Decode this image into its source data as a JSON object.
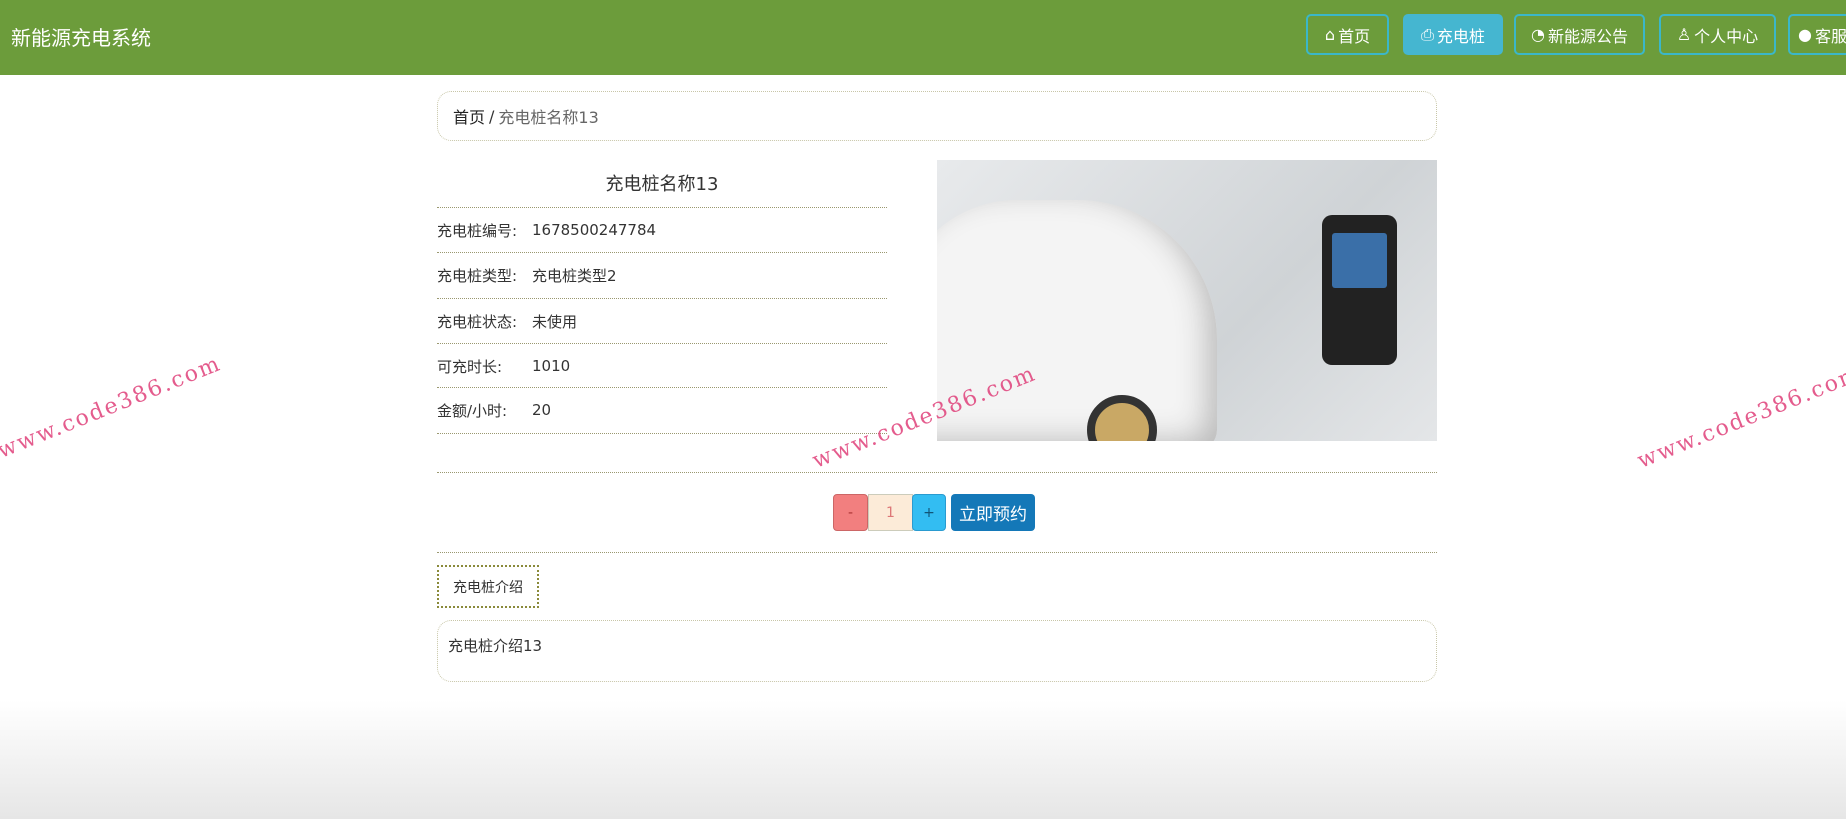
{
  "header": {
    "brand": "新能源充电系统",
    "nav": [
      {
        "label": "首页",
        "icon": "home-icon"
      },
      {
        "label": "充电桩",
        "icon": "charger-icon"
      },
      {
        "label": "新能源公告",
        "icon": "palette-icon"
      },
      {
        "label": "个人中心",
        "icon": "user-icon"
      },
      {
        "label": "客服",
        "icon": "chat-icon"
      }
    ]
  },
  "breadcrumb": {
    "home": "首页",
    "sep": "/",
    "current": "充电桩名称13"
  },
  "detail": {
    "title": "充电桩名称13",
    "fields": [
      {
        "label": "充电桩编号:",
        "value": "1678500247784"
      },
      {
        "label": "充电桩类型:",
        "value": "充电桩类型2"
      },
      {
        "label": "充电桩状态:",
        "value": "未使用"
      },
      {
        "label": "可充时长:",
        "value": "1010"
      },
      {
        "label": "金额/小时:",
        "value": "20"
      }
    ]
  },
  "booking": {
    "minus": "-",
    "quantity": "1",
    "plus": "+",
    "book": "立即预约"
  },
  "tabs": {
    "intro": "充电桩介绍"
  },
  "intro": {
    "text": "充电桩介绍13"
  },
  "watermark": "www.code386.com",
  "colors": {
    "header": "#6c9c3b",
    "active": "#45b6d0",
    "book": "#1478b8"
  }
}
